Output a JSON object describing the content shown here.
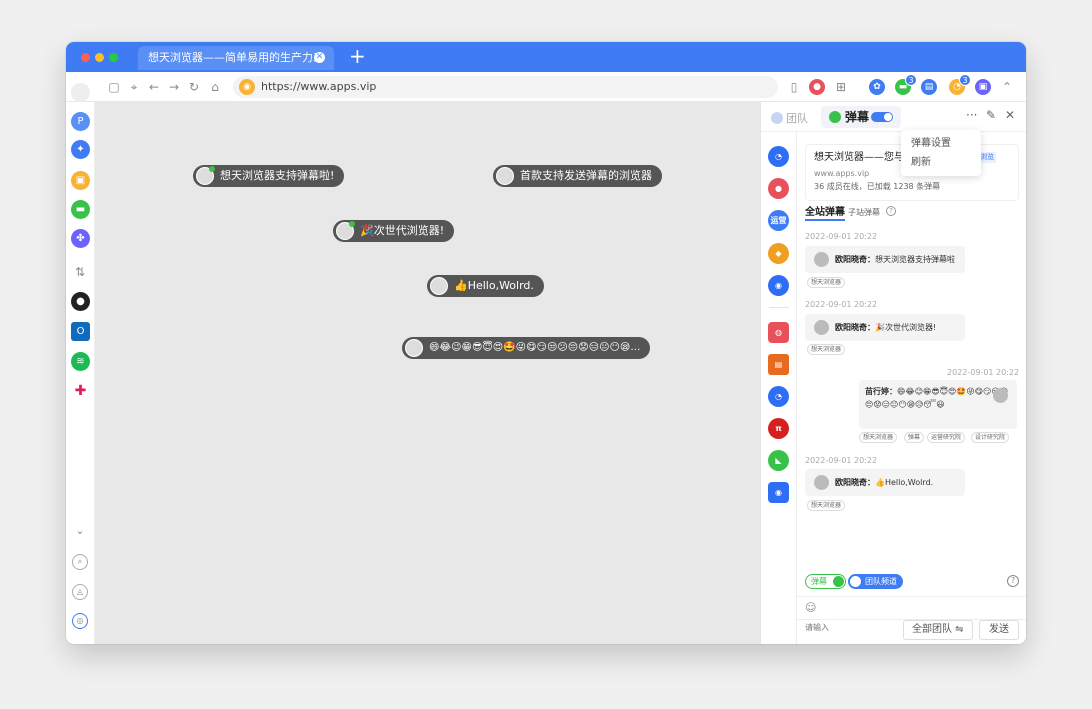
{
  "tab": {
    "title": "想天浏览器——简单易用的生产力工具",
    "close": "✕",
    "new": "+"
  },
  "toolbar": {
    "url": "https://www.apps.vip",
    "badge1": "3",
    "badge2": "3"
  },
  "bullets": [
    "想天浏览器支持弹幕啦!",
    "首款支持发送弹幕的浏览器",
    "🎉次世代浏览器!",
    "👍Hello,Wolrd.",
    "😄😂😉😁😎😇😍🤩😜😋😏😒😕😔😟😑😐😶😪…"
  ],
  "panel": {
    "team_tab": "团队",
    "danmaku_tab": "弹幕",
    "more": "···",
    "menu": [
      "弹幕设置",
      "刷新"
    ],
    "site_card": {
      "title": "想天浏览器——您与团",
      "tag": "浏览",
      "url": "www.apps.vip",
      "stats": "36 成员在线，已加载 1238 条弹幕"
    },
    "subtab_all": "全站弹幕",
    "subtab_sub": "子站弹幕",
    "messages": [
      {
        "time": "2022-09-01 20:22",
        "name": "欧阳晓奇：",
        "text": "想天浏览器支持弹幕啦",
        "tags": [
          "想天浏览器"
        ]
      },
      {
        "time": "2022-09-01 20:22",
        "name": "欧阳晓奇：",
        "text": "🎉次世代浏览器!",
        "tags": [
          "想天浏览器"
        ]
      },
      {
        "time": "2022-09-01 20:22",
        "name": "苗行婷：",
        "text": "😄😂😉😁😎😇😍🤩😜😋😏😒😕😔😟😑😐😶😪😥😴😃",
        "tags": [
          "想天浏览器",
          "弹幕",
          "运营研究院",
          "设计研究院"
        ]
      },
      {
        "time": "2022-09-01 20:22",
        "name": "欧阳晓奇：",
        "text": "👍Hello,Wolrd.",
        "tags": [
          "想天浏览器"
        ]
      }
    ],
    "toggle_danmaku": "弹幕",
    "toggle_team": "团队频道",
    "input_placeholder": "请输入",
    "scope": "全部团队",
    "send": "发送"
  },
  "team_icons": [
    "运营"
  ]
}
